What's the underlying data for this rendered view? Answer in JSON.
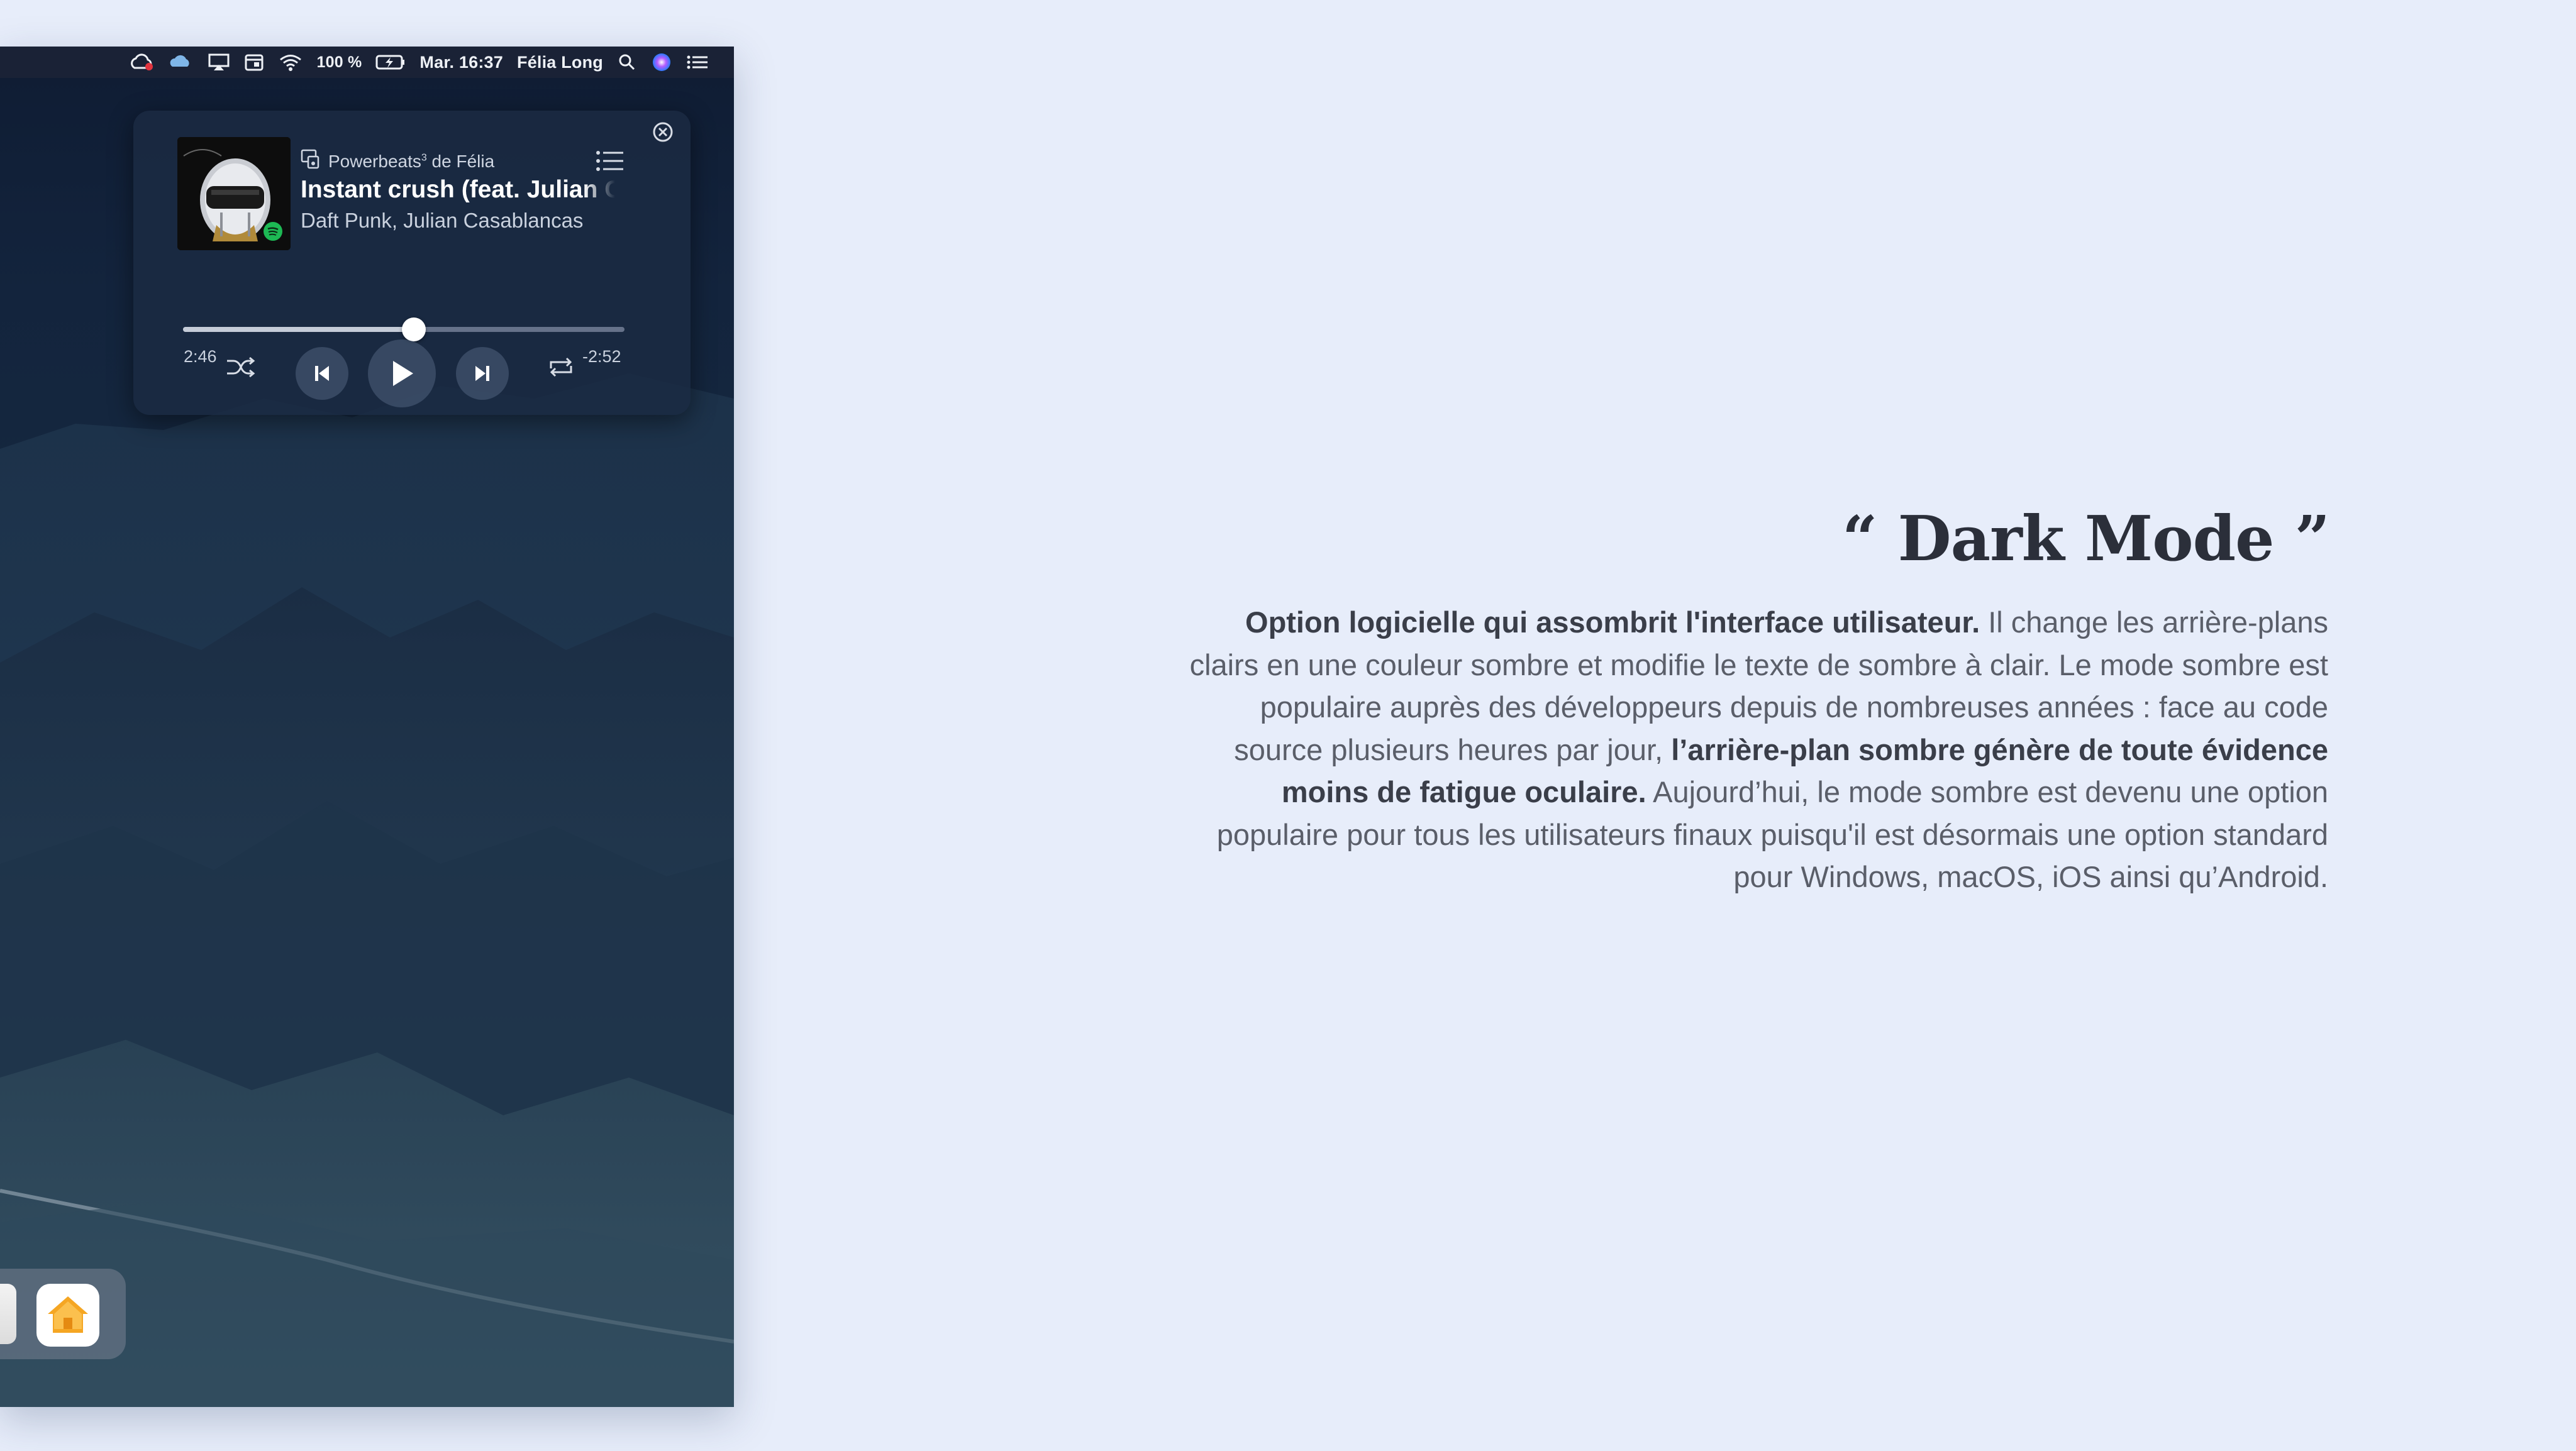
{
  "menubar": {
    "battery_percent": "100 %",
    "datetime": "Mar. 16:37",
    "user_name": "Félia Long",
    "icons": [
      "creative-cloud-icon",
      "cloud-sync-icon",
      "airplay-icon",
      "calendar-icon",
      "wifi-icon",
      "battery-icon",
      "search-icon",
      "siri-icon",
      "notification-center-icon"
    ]
  },
  "player": {
    "device_prefix": "Powerbeats",
    "device_sup": "3",
    "device_suffix": " de Félia",
    "title": "Instant crush (feat. Julian Casablancas)",
    "artist": "Daft Punk, Julian Casablancas",
    "elapsed": "2:46",
    "remaining": "-2:52",
    "progress_fraction": 0.523,
    "icons": [
      "shuffle-icon",
      "previous-icon",
      "play-icon",
      "next-icon",
      "repeat-icon",
      "queue-list-icon",
      "close-icon",
      "speaker-device-icon",
      "spotify-icon"
    ]
  },
  "dock": {
    "apps": [
      "home-app-icon"
    ]
  },
  "article": {
    "heading": "“ Dark Mode ”",
    "p1_strong": "Option logicielle qui assombrit l'interface utilisateur.",
    "p1_rest": " Il change les arrière-plans clairs en une couleur sombre et modifie le texte de sombre à clair.",
    "p2_start": "Le mode sombre est populaire auprès des développeurs depuis de nombreuses années : face au code source plusieurs heures par jour, ",
    "p2_strong": "l’arrière-plan sombre génère de toute évidence moins de fatigue oculaire.",
    "p3": "Aujourd’hui, le mode sombre est devenu une option populaire pour tous les utilisateurs finaux puisqu'il est désormais une option standard pour Windows, macOS, iOS ainsi qu’Android."
  },
  "colors": {
    "page_background": "#e7edfa",
    "heading": "#2b2f3a",
    "body_text": "#5a5e69",
    "spotify_green": "#1db954",
    "home_orange": "#f5a623"
  }
}
